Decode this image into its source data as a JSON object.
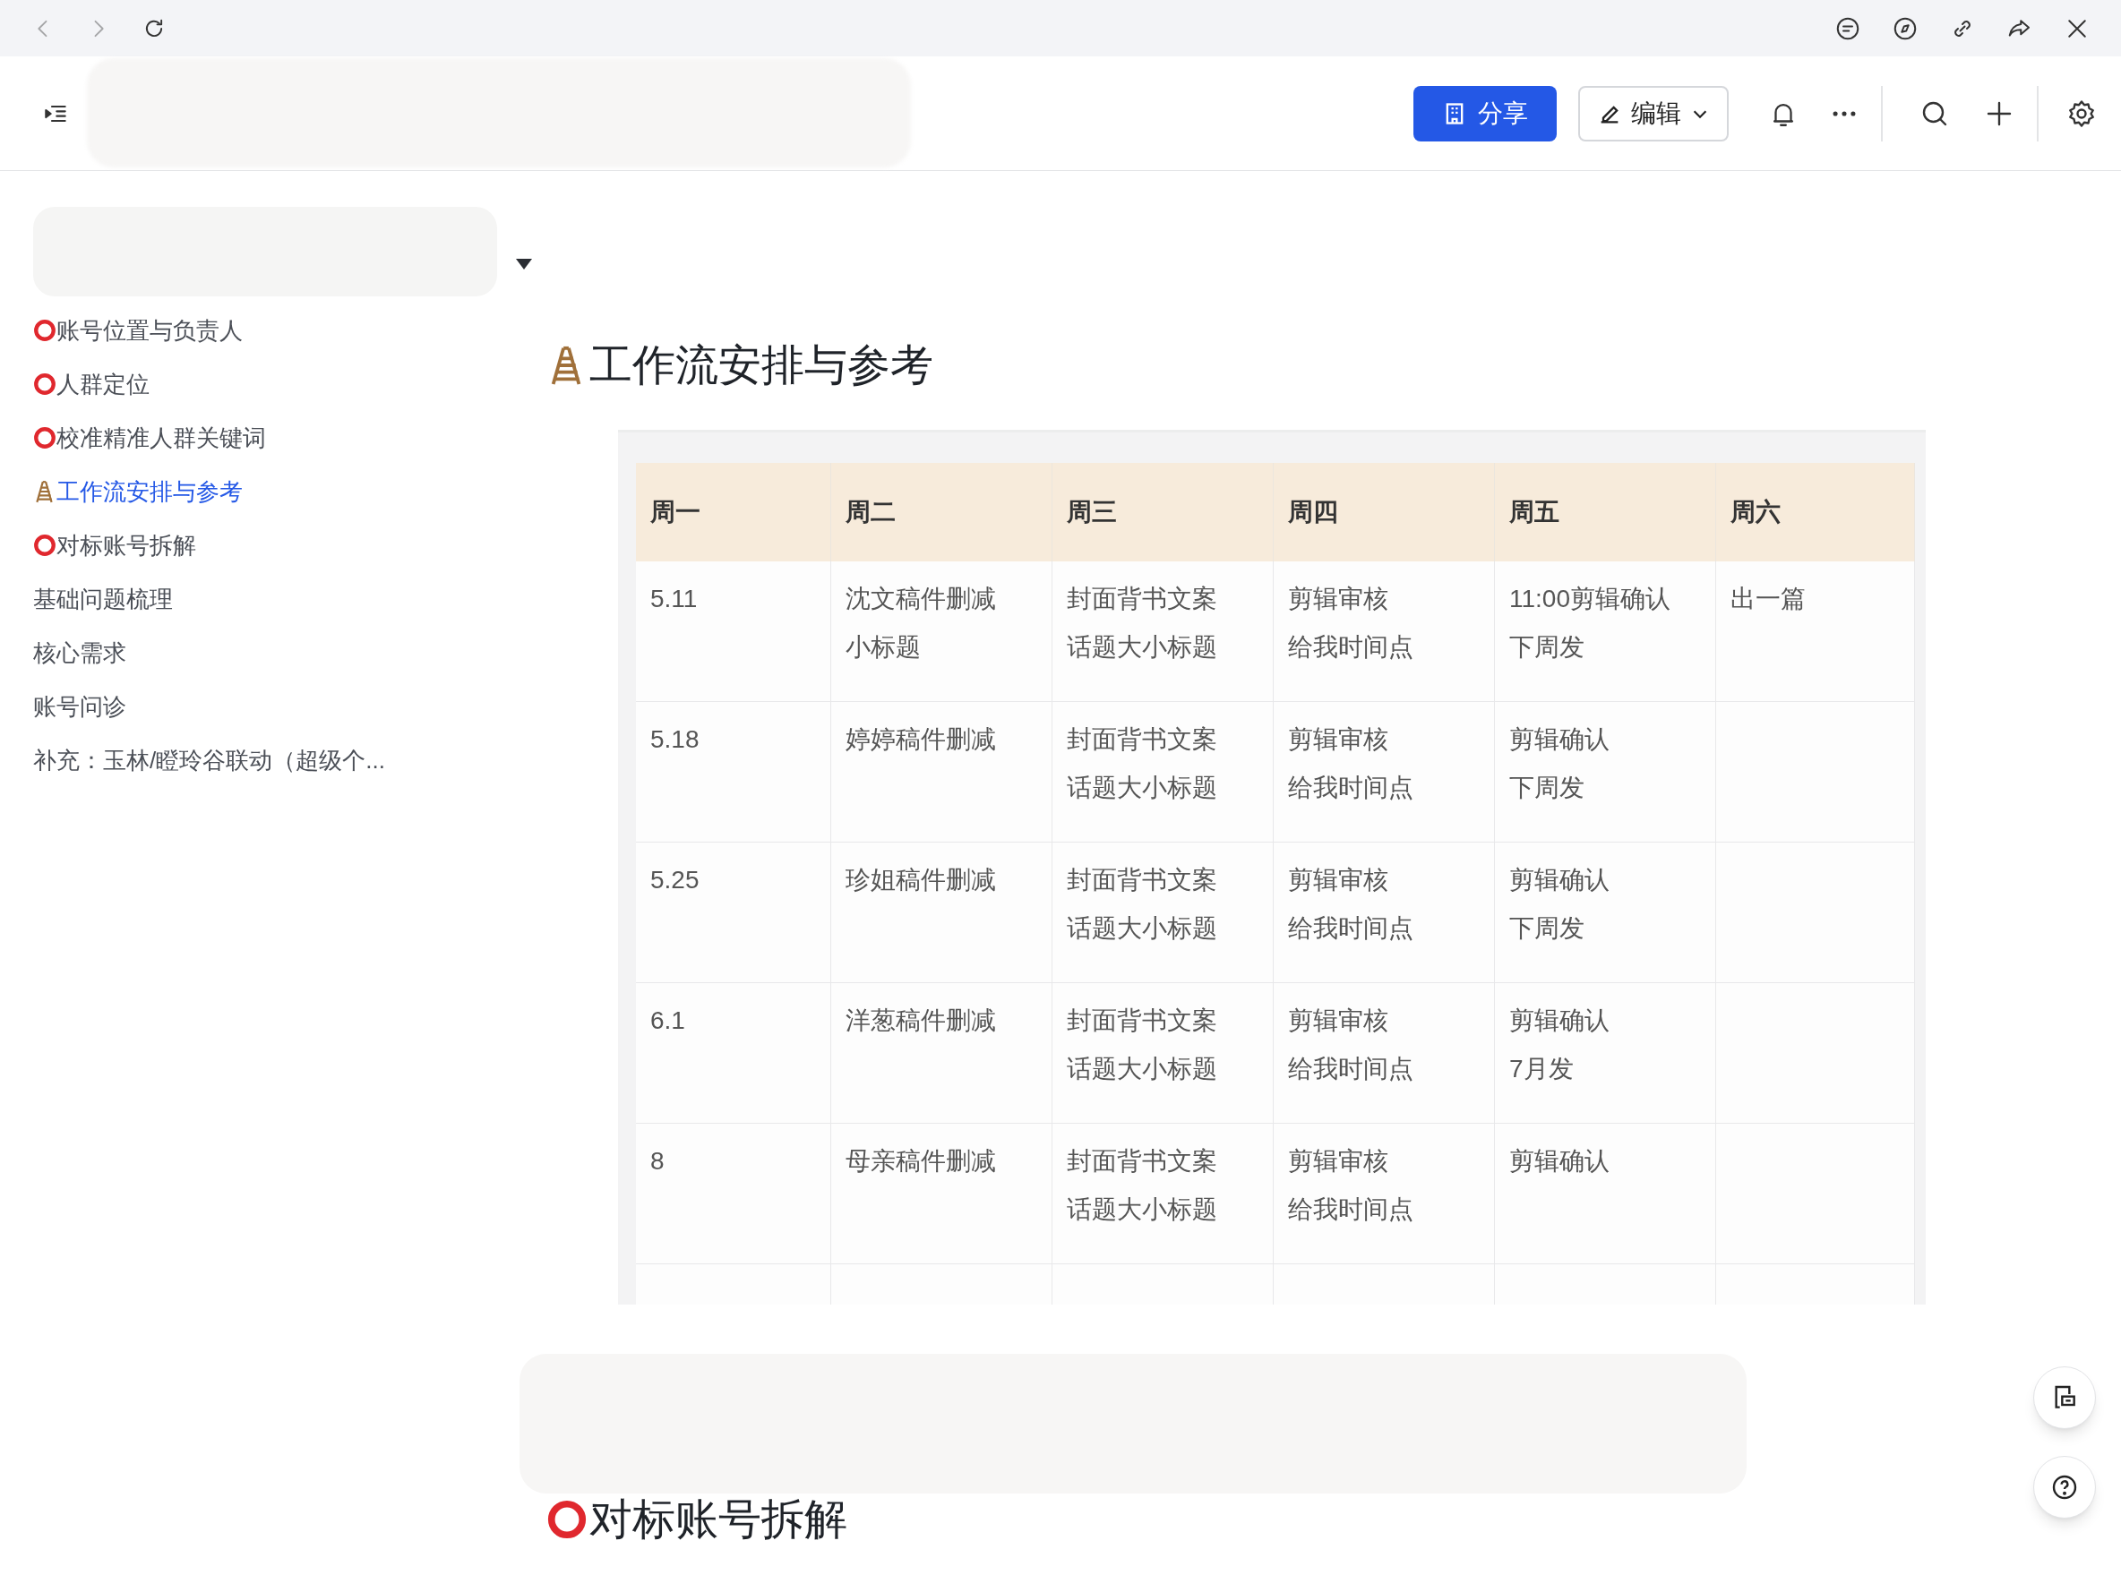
{
  "toolbar": {
    "share_button": "分享",
    "edit_button": "编辑"
  },
  "sidebar": {
    "items": [
      {
        "label": "账号位置与负责人",
        "kind": "ring",
        "selected": false
      },
      {
        "label": "人群定位",
        "kind": "ring",
        "selected": false
      },
      {
        "label": "校准精准人群关键词",
        "kind": "ring",
        "selected": false
      },
      {
        "label": "工作流安排与参考",
        "kind": "ladder",
        "selected": true
      },
      {
        "label": "对标账号拆解",
        "kind": "ring",
        "selected": false
      },
      {
        "label": "基础问题梳理",
        "kind": "plain",
        "selected": false
      },
      {
        "label": "核心需求",
        "kind": "plain",
        "selected": false
      },
      {
        "label": "账号问诊",
        "kind": "plain",
        "selected": false
      },
      {
        "label": "补充：玉林/瞪玲谷联动（超级个...",
        "kind": "plain",
        "selected": false
      }
    ]
  },
  "sections": [
    {
      "heading": "工作流安排与参考",
      "kind": "ladder",
      "table": {
        "columns": [
          "周一",
          "周二",
          "周三",
          "周四",
          "周五",
          "周六"
        ],
        "rows": [
          [
            [
              "5.11"
            ],
            [
              "沈文稿件删减",
              "小标题"
            ],
            [
              "封面背书文案",
              "话题大小标题"
            ],
            [
              "剪辑审核",
              "给我时间点"
            ],
            [
              "11:00剪辑确认",
              "下周发"
            ],
            [
              "出一篇"
            ]
          ],
          [
            [
              "5.18"
            ],
            [
              "婷婷稿件删减"
            ],
            [
              "封面背书文案",
              "话题大小标题"
            ],
            [
              "剪辑审核",
              "给我时间点"
            ],
            [
              "剪辑确认",
              "下周发"
            ],
            []
          ],
          [
            [
              "5.25"
            ],
            [
              "珍姐稿件删减"
            ],
            [
              "封面背书文案",
              "话题大小标题"
            ],
            [
              "剪辑审核",
              "给我时间点"
            ],
            [
              "剪辑确认",
              "下周发"
            ],
            []
          ],
          [
            [
              "6.1"
            ],
            [
              "洋葱稿件删减"
            ],
            [
              "封面背书文案",
              "话题大小标题"
            ],
            [
              "剪辑审核",
              "给我时间点"
            ],
            [
              "剪辑确认",
              "7月发"
            ],
            []
          ],
          [
            [
              "8"
            ],
            [
              "母亲稿件删减"
            ],
            [
              "封面背书文案",
              "话题大小标题"
            ],
            [
              "剪辑审核",
              "给我时间点"
            ],
            [
              "剪辑确认"
            ],
            []
          ]
        ]
      }
    },
    {
      "heading": "对标账号拆解",
      "kind": "ring"
    }
  ]
}
